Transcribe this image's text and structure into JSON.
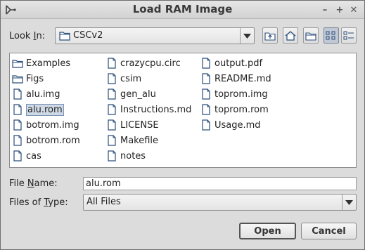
{
  "window": {
    "title": "Load RAM Image",
    "minimize_glyph": "–",
    "maximize_glyph": "+",
    "close_glyph": "✕"
  },
  "look_in": {
    "label_prefix": "Look ",
    "label_mnemonic": "I",
    "label_suffix": "n:",
    "value": "CSCv2"
  },
  "toolbar": {
    "up_icon": "up-one-level-icon",
    "home_icon": "home-icon",
    "new_folder_icon": "new-folder-icon",
    "list_view_icon": "list-view-icon",
    "details_view_icon": "details-view-icon",
    "active_view": "list"
  },
  "files": [
    {
      "name": "Examples",
      "type": "folder"
    },
    {
      "name": "Figs",
      "type": "folder"
    },
    {
      "name": "alu.img",
      "type": "file"
    },
    {
      "name": "alu.rom",
      "type": "file",
      "selected": true
    },
    {
      "name": "botrom.img",
      "type": "file"
    },
    {
      "name": "botrom.rom",
      "type": "file"
    },
    {
      "name": "cas",
      "type": "file"
    },
    {
      "name": "crazycpu.circ",
      "type": "file"
    },
    {
      "name": "csim",
      "type": "file"
    },
    {
      "name": "gen_alu",
      "type": "file"
    },
    {
      "name": "Instructions.md",
      "type": "file"
    },
    {
      "name": "LICENSE",
      "type": "file"
    },
    {
      "name": "Makefile",
      "type": "file"
    },
    {
      "name": "notes",
      "type": "file"
    },
    {
      "name": "output.pdf",
      "type": "file"
    },
    {
      "name": "README.md",
      "type": "file"
    },
    {
      "name": "toprom.img",
      "type": "file"
    },
    {
      "name": "toprom.rom",
      "type": "file"
    },
    {
      "name": "Usage.md",
      "type": "file"
    }
  ],
  "file_name": {
    "label_prefix": "File ",
    "label_mnemonic": "N",
    "label_suffix": "ame:",
    "value": "alu.rom"
  },
  "file_type": {
    "label_prefix": "Files of ",
    "label_mnemonic": "T",
    "label_suffix": "ype:",
    "value": "All Files"
  },
  "buttons": {
    "open": "Open",
    "cancel": "Cancel"
  },
  "colors": {
    "selection_bg": "#cfd9e6",
    "selection_border": "#7a93b8",
    "icon_blue": "#2a4d7a"
  }
}
